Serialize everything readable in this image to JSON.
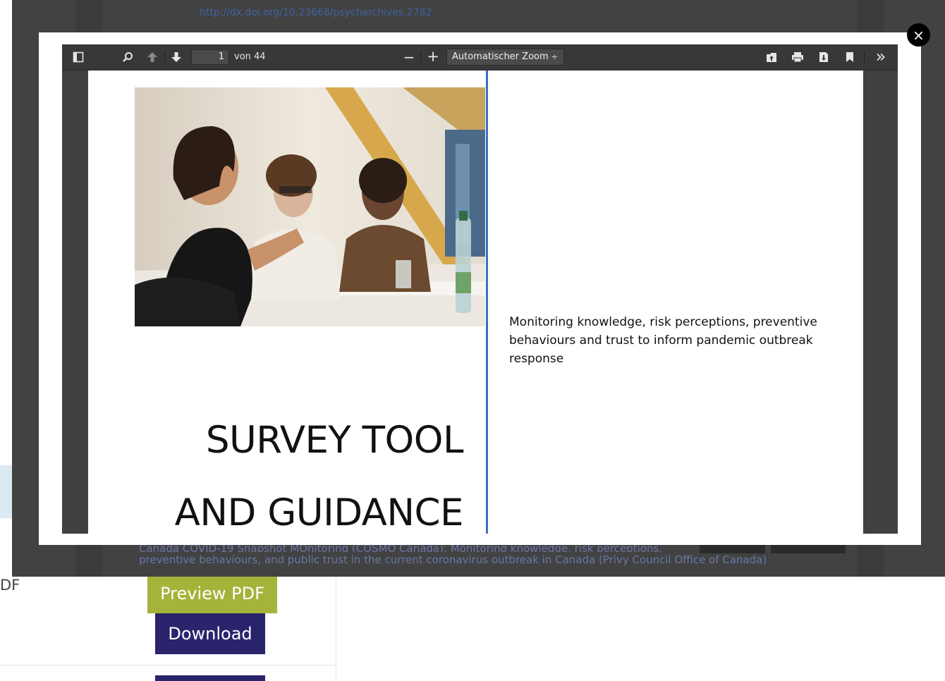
{
  "background": {
    "pdf_label_truncated": "DF",
    "preview_button": "Preview PDF",
    "download_button": "Download"
  },
  "overlay": {
    "doi_link": "http://dx.doi.org/10.23668/psycharchives.2782",
    "result_title_line1": "Canada COVID-19 Snapshot MOnitoring (COSMO Canada): Monitoring knowledge, risk perceptions,",
    "result_title_line2": "preventive behaviours, and public trust in the current coronavirus outbreak in Canada",
    "result_org_open": " (",
    "result_org": "Privy Council Office of Canada",
    "result_org_close": ")",
    "close_symbol": "×"
  },
  "viewer": {
    "page_number": "1",
    "page_of": "von 44",
    "zoom_minus": "−",
    "zoom_plus": "+",
    "zoom_value": "Automatischer Zoom",
    "zoom_arrows": "÷",
    "more_tools": "»",
    "icons": [
      "sidebar-toggle-icon",
      "search-icon",
      "previous-page-icon",
      "next-page-icon",
      "open-file-icon",
      "print-icon",
      "download-icon",
      "bookmark-icon",
      "tools-icon"
    ]
  },
  "document": {
    "title_line1": "SURVEY TOOL",
    "title_line2": "AND GUIDANCE",
    "subtitle": "Monitoring knowledge, risk perceptions, preventive behaviours and trust to inform pandemic outbreak response"
  },
  "colors": {
    "accent_green": "#a5b33a",
    "accent_navy": "#2a246d",
    "divider_blue": "#3a72bf"
  }
}
